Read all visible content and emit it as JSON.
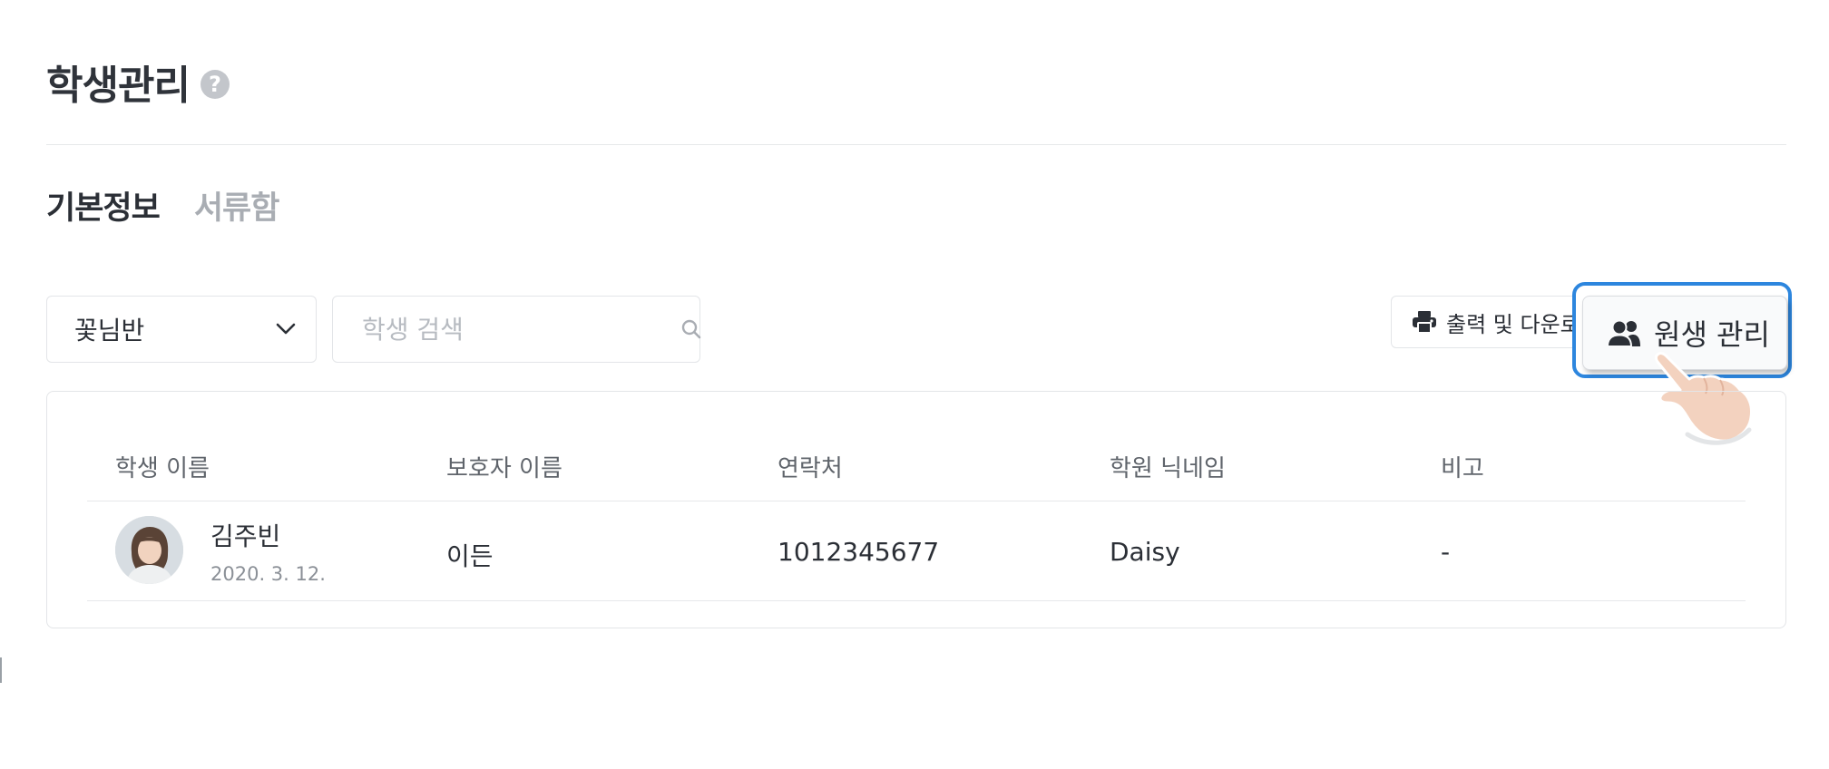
{
  "header": {
    "title": "학생관리",
    "help_icon": "help-circle-icon"
  },
  "tabs": [
    {
      "label": "기본정보",
      "active": true
    },
    {
      "label": "서류함",
      "active": false
    }
  ],
  "filters": {
    "class_select": {
      "value": "꽃님반",
      "icon": "chevron-down-icon"
    },
    "search": {
      "placeholder": "학생 검색",
      "icon": "search-icon"
    }
  },
  "actions": {
    "print_label": "출력 및 다운로드",
    "print_icon": "printer-icon",
    "manage_label": "원생 관리",
    "manage_icon": "users-icon",
    "highlight_color": "#2d86de"
  },
  "table": {
    "columns": [
      "학생 이름",
      "보호자 이름",
      "연락처",
      "학원 닉네임",
      "비고"
    ],
    "rows": [
      {
        "student_name": "김주빈",
        "birth_date": "2020. 3. 12.",
        "guardian_name": "이든",
        "contact": "1012345677",
        "nickname": "Daisy",
        "note": "-"
      }
    ]
  }
}
